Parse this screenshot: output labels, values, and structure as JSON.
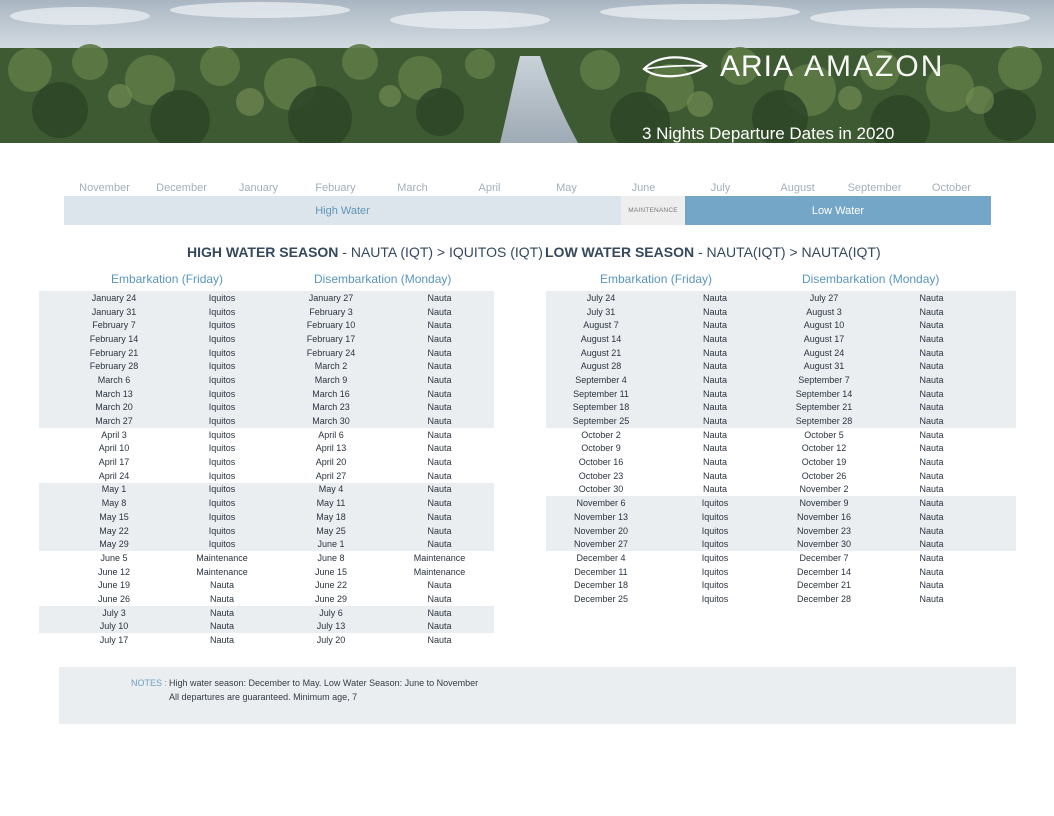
{
  "header": {
    "brand_word1": "ARIA",
    "brand_word2": "AMAZON",
    "title": "3 Nights Departure Dates in 2020"
  },
  "season_band": {
    "months": [
      "November",
      "December",
      "January",
      "Febuary",
      "March",
      "April",
      "May",
      "June",
      "July",
      "August",
      "September",
      "October"
    ],
    "high_label": "High Water",
    "maintenance_label": "MAINTENANCE",
    "low_label": "Low Water",
    "colors": {
      "high": "#dce5ec",
      "maintenance": "#eeeeee",
      "low": "#74a6c7"
    }
  },
  "high_section": {
    "title_bold": "HIGH WATER SEASON",
    "title_rest": " - NAUTA (IQT) > IQUITOS (IQT)",
    "embark_header": "Embarkation (Friday)",
    "disembark_header": "Disembarkation (Monday)",
    "rows": [
      [
        "January 24",
        "Iquitos",
        "January 27",
        "Nauta"
      ],
      [
        "January 31",
        "Iquitos",
        "February 3",
        "Nauta"
      ],
      [
        "February 7",
        "Iquitos",
        "February 10",
        "Nauta"
      ],
      [
        "February 14",
        "Iquitos",
        "February 17",
        "Nauta"
      ],
      [
        "February 21",
        "Iquitos",
        "February 24",
        "Nauta"
      ],
      [
        "February 28",
        "Iquitos",
        "March 2",
        "Nauta"
      ],
      [
        "March 6",
        "Iquitos",
        "March 9",
        "Nauta"
      ],
      [
        "March 13",
        "Iquitos",
        "March 16",
        "Nauta"
      ],
      [
        "March 20",
        "Iquitos",
        "March 23",
        "Nauta"
      ],
      [
        "March 27",
        "Iquitos",
        "March 30",
        "Nauta"
      ],
      [
        "April 3",
        "Iquitos",
        "April 6",
        "Nauta"
      ],
      [
        "April 10",
        "Iquitos",
        "April 13",
        "Nauta"
      ],
      [
        "April 17",
        "Iquitos",
        "April 20",
        "Nauta"
      ],
      [
        "April 24",
        "Iquitos",
        "April 27",
        "Nauta"
      ],
      [
        "May 1",
        "Iquitos",
        "May 4",
        "Nauta"
      ],
      [
        "May 8",
        "Iquitos",
        "May 11",
        "Nauta"
      ],
      [
        "May 15",
        "Iquitos",
        "May 18",
        "Nauta"
      ],
      [
        "May 22",
        "Iquitos",
        "May 25",
        "Nauta"
      ],
      [
        "May 29",
        "Iquitos",
        "June 1",
        "Nauta"
      ],
      [
        "June 5",
        "Maintenance",
        "June 8",
        "Maintenance"
      ],
      [
        "June 12",
        "Maintenance",
        "June 15",
        "Maintenance"
      ],
      [
        "June 19",
        "Nauta",
        "June 22",
        "Nauta"
      ],
      [
        "June 26",
        "Nauta",
        "June 29",
        "Nauta"
      ],
      [
        "July 3",
        "Nauta",
        "July 6",
        "Nauta"
      ],
      [
        "July 10",
        "Nauta",
        "July 13",
        "Nauta"
      ],
      [
        "July 17",
        "Nauta",
        "July 20",
        "Nauta"
      ]
    ],
    "shaded": [
      true,
      true,
      true,
      true,
      true,
      true,
      true,
      true,
      true,
      true,
      false,
      false,
      false,
      false,
      true,
      true,
      true,
      true,
      true,
      false,
      false,
      false,
      false,
      true,
      true,
      false
    ]
  },
  "low_section": {
    "title_bold": "LOW WATER SEASON",
    "title_rest": " - NAUTA(IQT) > NAUTA(IQT)",
    "embark_header": "Embarkation (Friday)",
    "disembark_header": "Disembarkation (Monday)",
    "rows": [
      [
        "July 24",
        "Nauta",
        "July 27",
        "Nauta"
      ],
      [
        "July 31",
        "Nauta",
        "August 3",
        "Nauta"
      ],
      [
        "August 7",
        "Nauta",
        "August 10",
        "Nauta"
      ],
      [
        "August 14",
        "Nauta",
        "August 17",
        "Nauta"
      ],
      [
        "August 21",
        "Nauta",
        "August 24",
        "Nauta"
      ],
      [
        "August 28",
        "Nauta",
        "August 31",
        "Nauta"
      ],
      [
        "September 4",
        "Nauta",
        "September 7",
        "Nauta"
      ],
      [
        "September 11",
        "Nauta",
        "September 14",
        "Nauta"
      ],
      [
        "September 18",
        "Nauta",
        "September 21",
        "Nauta"
      ],
      [
        "September 25",
        "Nauta",
        "September 28",
        "Nauta"
      ],
      [
        "October 2",
        "Nauta",
        "October 5",
        "Nauta"
      ],
      [
        "October 9",
        "Nauta",
        "October 12",
        "Nauta"
      ],
      [
        "October 16",
        "Nauta",
        "October 19",
        "Nauta"
      ],
      [
        "October 23",
        "Nauta",
        "October 26",
        "Nauta"
      ],
      [
        "October 30",
        "Nauta",
        "November 2",
        "Nauta"
      ],
      [
        "November 6",
        "Iquitos",
        "November 9",
        "Nauta"
      ],
      [
        "November 13",
        "Iquitos",
        "November 16",
        "Nauta"
      ],
      [
        "November 20",
        "Iquitos",
        "November 23",
        "Nauta"
      ],
      [
        "November 27",
        "Iquitos",
        "November 30",
        "Nauta"
      ],
      [
        "December 4",
        "Iquitos",
        "December 7",
        "Nauta"
      ],
      [
        "December 11",
        "Iquitos",
        "December 14",
        "Nauta"
      ],
      [
        "December 18",
        "Iquitos",
        "December 21",
        "Nauta"
      ],
      [
        "December 25",
        "Iquitos",
        "December 28",
        "Nauta"
      ]
    ],
    "shaded": [
      true,
      true,
      true,
      true,
      true,
      true,
      true,
      true,
      true,
      true,
      false,
      false,
      false,
      false,
      false,
      true,
      true,
      true,
      true,
      false,
      false,
      false,
      false
    ]
  },
  "notes": {
    "label": "NOTES :",
    "line1": "High water season: December to May. Low Water Season: June to November",
    "line2": "All departures are guaranteed. Minimum age, 7"
  }
}
